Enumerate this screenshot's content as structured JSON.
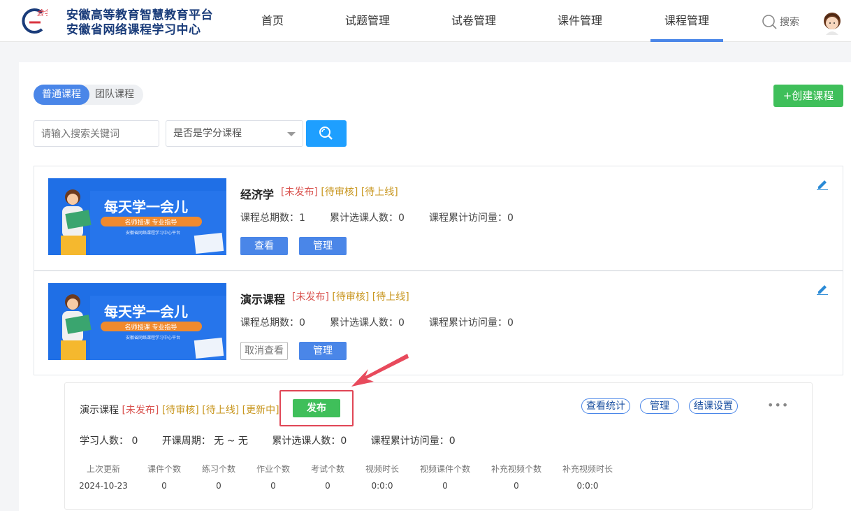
{
  "header": {
    "title_line1": "安徽高等教育智慧教育平台",
    "title_line2": "安徽省网络课程学习中心",
    "nav": [
      {
        "label": "首页"
      },
      {
        "label": "试题管理"
      },
      {
        "label": "试卷管理"
      },
      {
        "label": "课件管理"
      },
      {
        "label": "课程管理"
      }
    ],
    "search_label": "搜索",
    "accent": "#4a86e8"
  },
  "filters": {
    "tabs": [
      {
        "label": "普通课程"
      },
      {
        "label": "团队课程"
      }
    ],
    "create_label": "+创建课程",
    "search_placeholder": "请输入搜索关键词",
    "select_value": "是否是学分课程"
  },
  "thumb": {
    "headline": "每天学一会儿",
    "ribbon": "名师授课 专业指导",
    "caption": "安徽省网络课程学习中心平台"
  },
  "courses": [
    {
      "title": "经济学",
      "tag1": "[未发布]",
      "tag2": "[待审核]",
      "tag3": "[待上线]",
      "periods": "课程总期数：1",
      "selected": "累计选课人数：0",
      "visits": "课程累计访问量：0",
      "btn1": "查看",
      "btn2": "管理"
    },
    {
      "title": "演示课程",
      "tag1": "[未发布]",
      "tag2": "[待审核]",
      "tag3": "[待上线]",
      "periods": "课程总期数：0",
      "selected": "累计选课人数：0",
      "visits": "课程累计访问量：0",
      "btn1": "取消查看",
      "btn2": "管理"
    }
  ],
  "detail": {
    "name": "演示课程",
    "tag1": "[未发布]",
    "tag2": "[待审核]",
    "tag3": "[待上线]",
    "tag4": "[更新中]",
    "publish_label": "发布",
    "actions": [
      {
        "label": "查看统计"
      },
      {
        "label": "管理"
      },
      {
        "label": "结课设置"
      }
    ],
    "more": "•••",
    "learners": "学习人数：  0",
    "period": "开课周期：  无 ~ 无",
    "selected": "累计选课人数：0",
    "visits": "课程累计访问量：0",
    "columns": [
      "上次更新",
      "课件个数",
      "练习个数",
      "作业个数",
      "考试个数",
      "视频时长",
      "视频课件个数",
      "补充视频个数",
      "补充视频时长"
    ],
    "values": [
      "2024-10-23",
      "0",
      "0",
      "0",
      "0",
      "0:0:0",
      "0",
      "0",
      "0:0:0"
    ]
  }
}
